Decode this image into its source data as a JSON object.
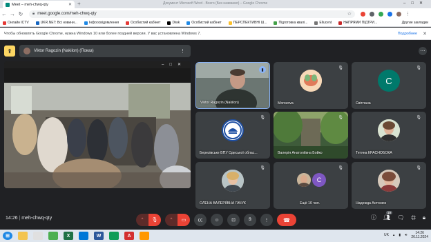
{
  "browser": {
    "tab_title": "Meet – meh-chwq-qty",
    "window_title": "Документ Microsoft Word - Всего (Без названия) – Google Chrome",
    "url": "meet.google.com/meh-chwq-qty"
  },
  "bookmarks": [
    {
      "label": "Онлайн ICTV",
      "color": "#e53935"
    },
    {
      "label": "UKR.NET: Всі новини...",
      "color": "#1565c0"
    },
    {
      "label": "Інфоосвідомлення",
      "color": "#1e88e5"
    },
    {
      "label": "Особистий кабінет",
      "color": "#e53935"
    },
    {
      "label": "Diwk",
      "color": "#000000"
    },
    {
      "label": "Особистий кабінет",
      "color": "#1e88e5"
    },
    {
      "label": "ПЕРСПЕКТИВНІ Ш...",
      "color": "#fbc02d"
    },
    {
      "label": "Підготовка квалі...",
      "color": "#43a047"
    },
    {
      "label": "Ellucent",
      "color": "#757575"
    },
    {
      "label": "НАПРЯМИ ПІДТРИ...",
      "color": "#c62828"
    }
  ],
  "bookmarks_other": "Другие закладки",
  "infobar": {
    "text": "Чтобы обновлять Google Chrome, нужна Windows 10 или более поздней версии. У вас установлена Windows 7.",
    "button": "Подробнее"
  },
  "meet": {
    "presenter": "Viktor Ragozin (Nakilon) (Показ)",
    "meeting_time": "14:26",
    "meeting_code": "meh-chwq-qty",
    "people_count": "19"
  },
  "participants": [
    {
      "name": "Viktor Ragozin (Nakilon)",
      "speaking": true
    },
    {
      "name": "Morozova"
    },
    {
      "name": "Світлана",
      "initial": "C",
      "color": "#00796b"
    },
    {
      "name": "Березівське ВПУ Одеської облас..."
    },
    {
      "name": "Валерія Анатоліївна Бойко"
    },
    {
      "name": "Тетяна КРАСНОБОКА"
    },
    {
      "name": "ОЛЕНА ВАЛЕРІЇВНА ГАЧУК"
    },
    {
      "name": "Ещё 10 чел.",
      "initial": "C",
      "color": "#7e57c2"
    },
    {
      "name": "Надежда Антонюк"
    }
  ],
  "taskbar": {
    "lang": "UK",
    "time": "14:26",
    "date": "26.11.2024"
  },
  "colors": {
    "meet_bg": "#202124",
    "tile_bg": "#3c4043",
    "danger": "#ea4335",
    "accent": "#8ab4f8"
  }
}
